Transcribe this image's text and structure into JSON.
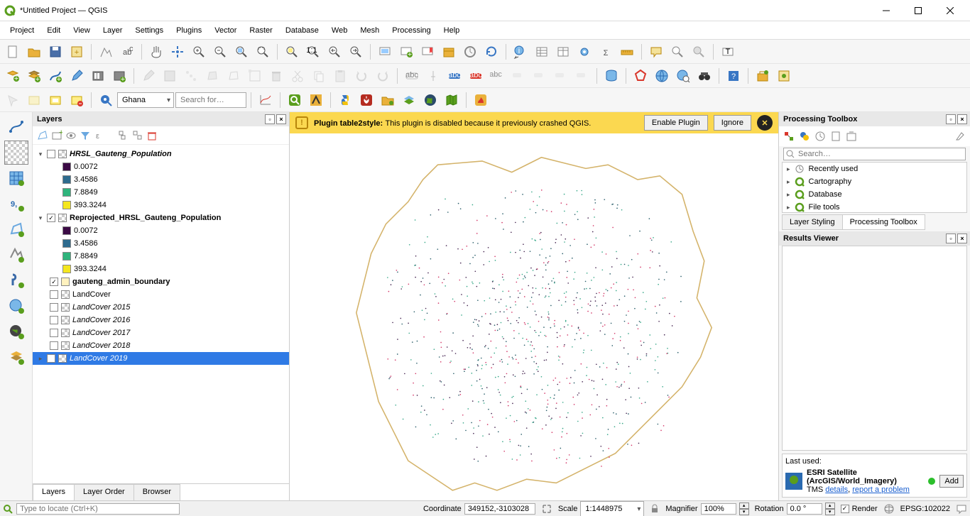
{
  "window": {
    "title": "*Untitled Project — QGIS"
  },
  "menu": {
    "items": [
      "Project",
      "Edit",
      "View",
      "Layer",
      "Settings",
      "Plugins",
      "Vector",
      "Raster",
      "Database",
      "Web",
      "Mesh",
      "Processing",
      "Help"
    ]
  },
  "toolbar3": {
    "location_dropdown": "Ghana",
    "search_placeholder": "Search for…"
  },
  "banner": {
    "prefix": "Plugin table2style:",
    "message": "This plugin is disabled because it previously crashed QGIS.",
    "enable": "Enable Plugin",
    "ignore": "Ignore"
  },
  "layers_panel": {
    "title": "Layers",
    "tree": [
      {
        "type": "group",
        "expanded": true,
        "checked": false,
        "checker": true,
        "name": "HRSL_Gauteng_Population",
        "italic": true,
        "bold": true,
        "children": [
          {
            "type": "val",
            "color": "#3b0a45",
            "label": "0.0072"
          },
          {
            "type": "val",
            "color": "#2e6b8e",
            "label": "3.4586"
          },
          {
            "type": "val",
            "color": "#2fb47c",
            "label": "7.8849"
          },
          {
            "type": "val",
            "color": "#f4e61e",
            "label": "393.3244"
          }
        ]
      },
      {
        "type": "group",
        "expanded": true,
        "checked": true,
        "checker": true,
        "name": "Reprojected_HRSL_Gauteng_Population",
        "bold": true,
        "children": [
          {
            "type": "val",
            "color": "#3b0a45",
            "label": "0.0072"
          },
          {
            "type": "val",
            "color": "#2e6b8e",
            "label": "3.4586"
          },
          {
            "type": "val",
            "color": "#2fb47c",
            "label": "7.8849"
          },
          {
            "type": "val",
            "color": "#f4e61e",
            "label": "393.3244"
          }
        ]
      },
      {
        "type": "layer",
        "checked": true,
        "checker": false,
        "color": "#fff2bf",
        "name": "gauteng_admin_boundary",
        "bold": true
      },
      {
        "type": "layer",
        "checked": false,
        "checker": true,
        "name": "LandCover"
      },
      {
        "type": "layer",
        "checked": false,
        "checker": true,
        "name": "LandCover 2015",
        "italic": true
      },
      {
        "type": "layer",
        "checked": false,
        "checker": true,
        "name": "LandCover 2016",
        "italic": true
      },
      {
        "type": "layer",
        "checked": false,
        "checker": true,
        "name": "LandCover 2017",
        "italic": true
      },
      {
        "type": "layer",
        "checked": false,
        "checker": true,
        "name": "LandCover 2018",
        "italic": true
      },
      {
        "type": "layer",
        "checked": false,
        "checker": true,
        "name": "LandCover 2019",
        "italic": true,
        "selected": true
      }
    ],
    "tabs": [
      "Layers",
      "Layer Order",
      "Browser"
    ],
    "active_tab": 0
  },
  "processing": {
    "title": "Processing Toolbox",
    "search_placeholder": "Search…",
    "groups": [
      {
        "icon": "clock",
        "label": "Recently used"
      },
      {
        "icon": "q",
        "label": "Cartography"
      },
      {
        "icon": "q",
        "label": "Database"
      },
      {
        "icon": "q",
        "label": "File tools"
      }
    ],
    "tabs": [
      "Layer Styling",
      "Processing Toolbox"
    ],
    "active_tab": 1
  },
  "results": {
    "title": "Results Viewer"
  },
  "last_used": {
    "title": "Last used:",
    "name": "ESRI Satellite (ArcGIS/World_Imagery)",
    "prefix": "TMS",
    "details": "details",
    "report": "report a problem",
    "add": "Add"
  },
  "status": {
    "locator_placeholder": "Type to locate (Ctrl+K)",
    "coord_label": "Coordinate",
    "coord_value": "349152,-3103028",
    "scale_label": "Scale",
    "scale_value": "1:1448975",
    "magnifier_label": "Magnifier",
    "magnifier_value": "100%",
    "rotation_label": "Rotation",
    "rotation_value": "0.0 °",
    "render_label": "Render",
    "crs_label": "EPSG:102022"
  }
}
